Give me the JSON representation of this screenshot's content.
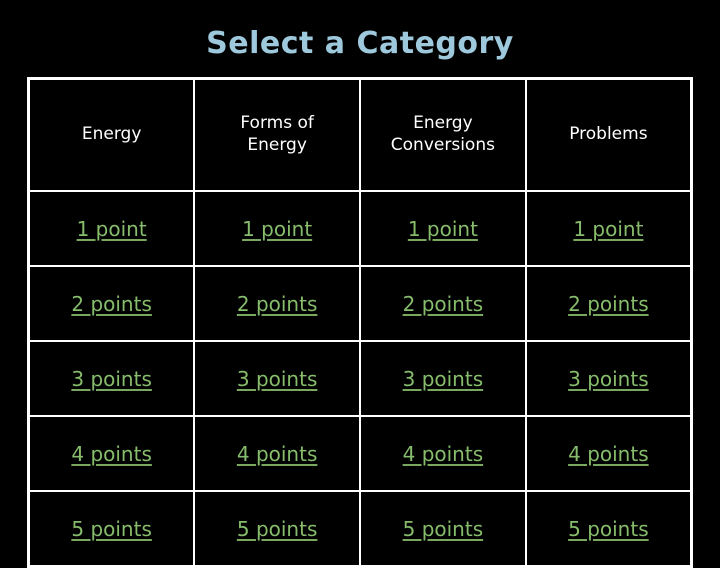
{
  "slide": {
    "title": "Select a Category",
    "background_color": "#000000",
    "title_color": "#9ec9dd",
    "border_color": "#ffffff",
    "header_text_color": "#ffffff",
    "link_color": "#86bc6b"
  },
  "table": {
    "columns": [
      {
        "label": "Energy"
      },
      {
        "label": "Forms of\nEnergy",
        "line1": "Forms of",
        "line2": "Energy"
      },
      {
        "label": "Energy\nConversions",
        "line1": "Energy",
        "line2": "Conversions"
      },
      {
        "label": "Problems"
      }
    ],
    "rows": [
      {
        "value": "1 point",
        "cells": [
          "1 point",
          "1 point",
          "1 point",
          "1 point"
        ]
      },
      {
        "value": "2 points",
        "cells": [
          "2 points",
          "2 points",
          "2 points",
          "2 points"
        ]
      },
      {
        "value": "3 points",
        "cells": [
          "3 points",
          "3 points",
          "3 points",
          "3 points"
        ]
      },
      {
        "value": "4 points",
        "cells": [
          "4 points",
          "4 points",
          "4 points",
          "4 points"
        ]
      },
      {
        "value": "5 points",
        "cells": [
          "5 points",
          "5 points",
          "5 points",
          "5 points"
        ]
      }
    ]
  }
}
